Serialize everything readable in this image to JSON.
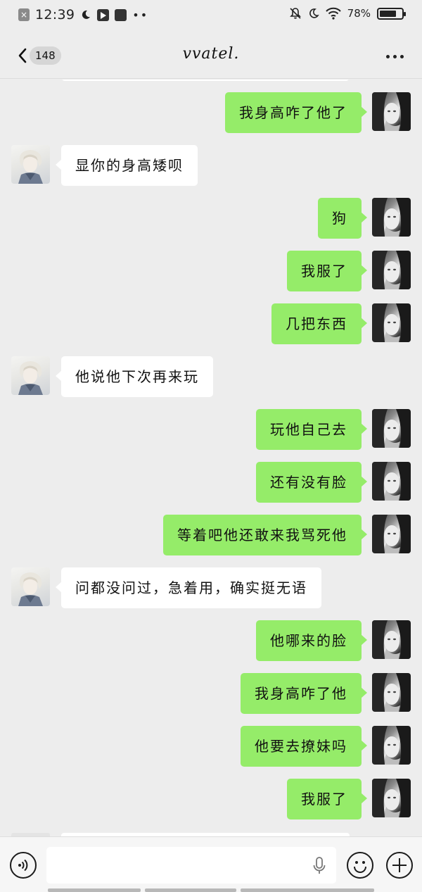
{
  "status_bar": {
    "time": "12:39",
    "dots": "••",
    "battery_text": "78%",
    "battery_level": 0.78
  },
  "header": {
    "unread_count": "148",
    "title": "vvatel."
  },
  "messages": [
    {
      "side": "right",
      "text": "我身高咋了他了"
    },
    {
      "side": "left",
      "text": "显你的身高矮呗"
    },
    {
      "side": "right",
      "text": "狗"
    },
    {
      "side": "right",
      "text": "我服了"
    },
    {
      "side": "right",
      "text": "几把东西"
    },
    {
      "side": "left",
      "text": "他说他下次再来玩"
    },
    {
      "side": "right",
      "text": "玩他自己去"
    },
    {
      "side": "right",
      "text": "还有没有脸"
    },
    {
      "side": "right",
      "text": "等着吧他还敢来我骂死他"
    },
    {
      "side": "left",
      "text": "问都没问过，急着用，确实挺无语"
    },
    {
      "side": "right",
      "text": "他哪来的脸"
    },
    {
      "side": "right",
      "text": "我身高咋了他"
    },
    {
      "side": "right",
      "text": "他要去撩妹吗"
    },
    {
      "side": "right",
      "text": "我服了"
    }
  ],
  "input": {
    "value": "",
    "placeholder": ""
  },
  "colors": {
    "background": "#ededed",
    "sent_bubble": "#95ec69",
    "received_bubble": "#ffffff"
  },
  "icons": {
    "back": "chevron-left-icon",
    "more": "more-dots-icon",
    "voice": "voice-icon",
    "mic": "mic-icon",
    "emoji": "emoji-icon",
    "plus": "plus-icon"
  }
}
